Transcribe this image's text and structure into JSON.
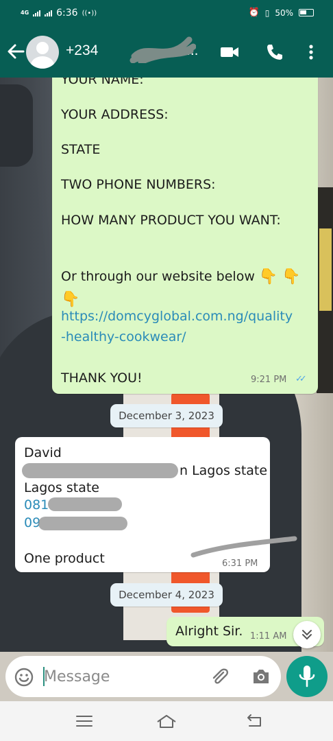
{
  "status_bar": {
    "network_type": "4G",
    "time": "6:36",
    "battery": "50%"
  },
  "header": {
    "contact_visible_prefix": "+234",
    "contact_suffix": "...",
    "icons": [
      "back-arrow-icon",
      "avatar",
      "video-call-icon",
      "phone-icon",
      "more-vert-icon"
    ]
  },
  "messages": {
    "outgoing_form": {
      "lines": [
        "YOUR NAME:",
        "YOUR ADDRESS:",
        "STATE",
        "TWO PHONE NUMBERS:",
        "HOW MANY PRODUCT YOU WANT:",
        "Or through our website below",
        "https://domcyglobal.com.ng/quality",
        "-healthy-cookwear/",
        "THANK YOU!"
      ],
      "time": "9:21 PM",
      "ticks": "✓✓"
    },
    "date_1": "December 3, 2023",
    "incoming_order": {
      "line_1": "David",
      "line_2_visible": "n Lagos state",
      "line_3": "Lagos state",
      "phone_1_visible": "081",
      "phone_2_visible": "09",
      "line_6": "One product",
      "time": "6:31 PM"
    },
    "date_2": "December 4, 2023",
    "outgoing_reply": {
      "text": "Alright Sir.",
      "time": "1:11 AM"
    }
  },
  "input": {
    "placeholder": "Message"
  },
  "colors": {
    "header_bg": "#075e54",
    "outgoing_bubble": "#dcf8c6",
    "incoming_bubble": "#ffffff",
    "link": "#2a8bb8",
    "mic_button": "#0f9d8a",
    "read_ticks": "#4fa5e8"
  }
}
